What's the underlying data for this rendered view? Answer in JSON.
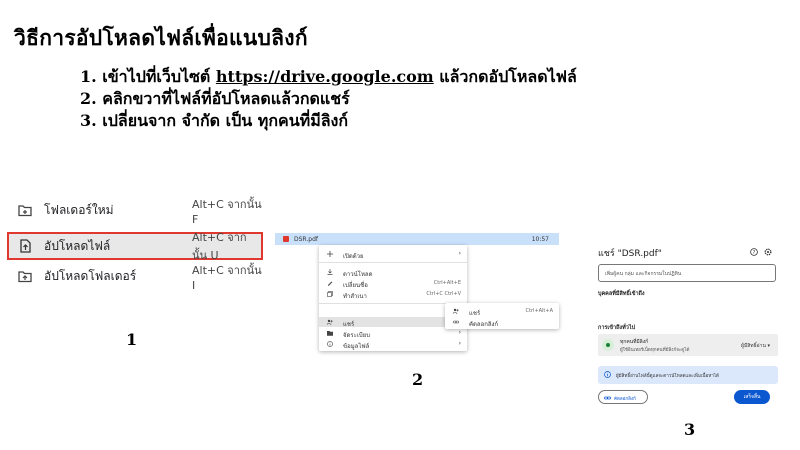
{
  "title": "วิธีการอัปโหลดไฟล์เพื่อแนบลิงก์",
  "steps": {
    "s1_prefix": "1. เข้าไปที่เว็บไซต์ ",
    "s1_link": "https://drive.google.com",
    "s1_suffix": " แล้วกดอัปโหลดไฟล์",
    "s2": "2. คลิกขวาที่ไฟล์ที่อัปโหลดแล้วกดแชร์",
    "s3": "3. เปลี่ยนจาก จำกัด เป็น ทุกคนที่มีลิงก์"
  },
  "panel1": {
    "number": "1",
    "items": [
      {
        "label": "โฟลเดอร์ใหม่",
        "shortcut": "Alt+C จากนั้น F",
        "icon": "new-folder-icon"
      },
      {
        "label": "อัปโหลดไฟล์",
        "shortcut": "Alt+C จากนั้น U",
        "icon": "file-upload-icon",
        "selected": true
      },
      {
        "label": "อัปโหลดโฟลเดอร์",
        "shortcut": "Alt+C จากนั้น I",
        "icon": "folder-upload-icon"
      }
    ],
    "highlight_color": "#e0382e"
  },
  "panel2": {
    "number": "2",
    "file_name": "DSR.pdf",
    "file_time": "10:57",
    "menu": [
      {
        "label": "เปิดด้วย",
        "shortcut": "",
        "submenu": true,
        "icon": "open-with-icon"
      },
      {
        "label": "ดาวน์โหลด",
        "shortcut": "",
        "icon": "download-icon"
      },
      {
        "label": "เปลี่ยนชื่อ",
        "shortcut": "Ctrl+Alt+E",
        "icon": "rename-icon"
      },
      {
        "label": "ทำสำเนา",
        "shortcut": "Ctrl+C Ctrl+V",
        "icon": "copy-icon"
      },
      {
        "label": "แชร์",
        "shortcut": "",
        "submenu": true,
        "icon": "share-icon",
        "highlighted": true
      },
      {
        "label": "จัดระเบียบ",
        "shortcut": "",
        "submenu": true,
        "icon": "organize-icon"
      },
      {
        "label": "ข้อมูลไฟล์",
        "shortcut": "",
        "submenu": true,
        "icon": "info-icon"
      }
    ],
    "submenu": [
      {
        "label": "แชร์",
        "shortcut": "Ctrl+Alt+A",
        "icon": "share-icon"
      },
      {
        "label": "คัดลอกลิงก์",
        "shortcut": "",
        "icon": "link-icon"
      }
    ]
  },
  "panel3": {
    "number": "3",
    "dialog_title": "แชร์ \"DSR.pdf\"",
    "add_placeholder": "เพิ่มผู้คน กลุ่ม และกิจกรรมในปฏิทิน",
    "people_section": "บุคคลที่มีสิทธิ์เข้าถึง",
    "general_section": "การเข้าถึงทั่วไป",
    "access_title": "ทุกคนที่มีลิงก์",
    "access_sub": "ผู้ใช้อินเทอร์เน็ตทุกคนที่มีลิงก์จะดูได้",
    "role": "ผู้มีสิทธิ์อ่าน",
    "info_text": "ผู้มีสิทธิ์อ่านไฟล์นี้ดูแลจะดาวน์โหลดและเพิ่มเนื้อหาได้",
    "copy_link": "คัดลอกลิงก์",
    "done": "เสร็จสิ้น",
    "accent_color": "#0b57d0"
  }
}
